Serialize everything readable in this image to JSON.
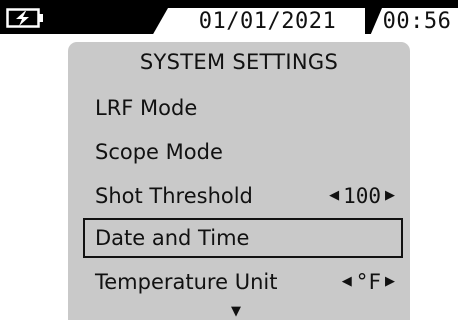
{
  "status_bar": {
    "battery_icon": "battery-charging-icon",
    "date": "01/01/2021",
    "time": "00:56"
  },
  "menu": {
    "title": "SYSTEM SETTINGS",
    "items": [
      {
        "label": "LRF Mode"
      },
      {
        "label": "Scope Mode"
      },
      {
        "label": "Shot Threshold",
        "value": "100"
      },
      {
        "label": "Date and Time",
        "selected": true
      },
      {
        "label": "Temperature Unit",
        "value": "°F"
      }
    ],
    "more_icon": "scroll-down-icon"
  },
  "colors": {
    "bar": "#000000",
    "panel": "#c9c9c9",
    "text": "#111111"
  }
}
